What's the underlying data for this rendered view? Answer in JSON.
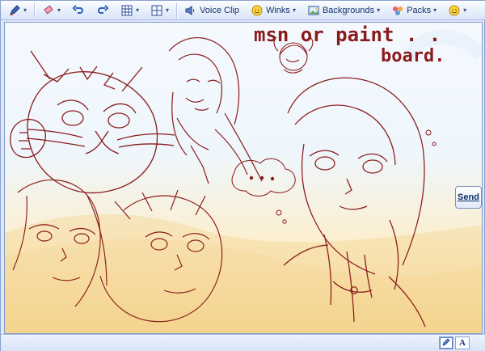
{
  "toolbar": {
    "voice_clip": "Voice Clip",
    "winks": "Winks",
    "backgrounds": "Backgrounds",
    "packs": "Packs"
  },
  "canvas": {
    "title_line1": "msn or paint . .",
    "title_line2": "board."
  },
  "send": {
    "label": "Send"
  },
  "bottom": {
    "text_mode_label": "A"
  },
  "colors": {
    "sketch": "#8a1b1b",
    "accent": "#15336a"
  }
}
